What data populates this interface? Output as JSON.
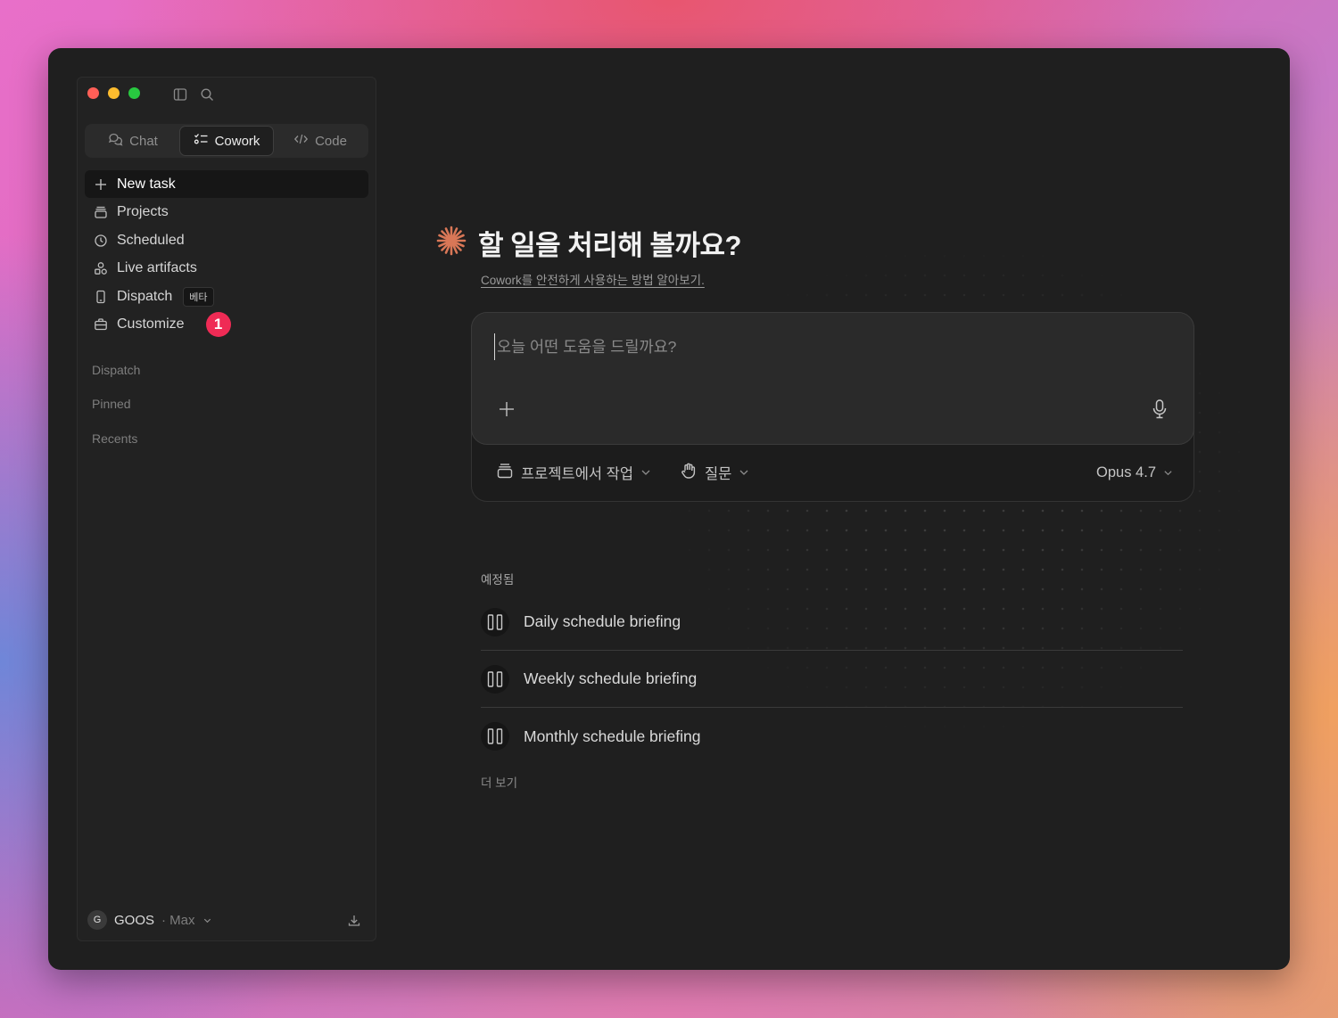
{
  "colors": {
    "accent": "#d97757",
    "badge": "#ef2b55",
    "window_bg": "#1f1f1f",
    "sidebar_bg": "#222222"
  },
  "sidebar": {
    "mode_tabs": [
      {
        "label": "Chat",
        "icon": "chat-bubbles-icon",
        "active": false
      },
      {
        "label": "Cowork",
        "icon": "checklist-icon",
        "active": true
      },
      {
        "label": "Code",
        "icon": "code-brackets-icon",
        "active": false
      }
    ],
    "nav": [
      {
        "label": "New task",
        "icon": "plus-icon",
        "active": true
      },
      {
        "label": "Projects",
        "icon": "folder-stack-icon"
      },
      {
        "label": "Scheduled",
        "icon": "clock-icon"
      },
      {
        "label": "Live artifacts",
        "icon": "shapes-icon"
      },
      {
        "label": "Dispatch",
        "icon": "phone-icon",
        "tag": "베타"
      },
      {
        "label": "Customize",
        "icon": "briefcase-icon",
        "badge": "1"
      }
    ],
    "sections": [
      "Dispatch",
      "Pinned",
      "Recents"
    ],
    "account": {
      "initial": "G",
      "name": "GOOS",
      "plan": "· Max"
    }
  },
  "main": {
    "title": "할 일을 처리해 볼까요?",
    "subtitle": "Cowork를 안전하게 사용하는 방법 알아보기.",
    "composer": {
      "placeholder": "오늘 어떤 도움을 드릴까요?",
      "project_label": "프로젝트에서 작업",
      "mode_label": "질문",
      "model_label": "Opus 4.7"
    },
    "scheduled": {
      "heading": "예정됨",
      "items": [
        "Daily schedule briefing",
        "Weekly schedule briefing",
        "Monthly schedule briefing"
      ],
      "more": "더 보기"
    }
  }
}
